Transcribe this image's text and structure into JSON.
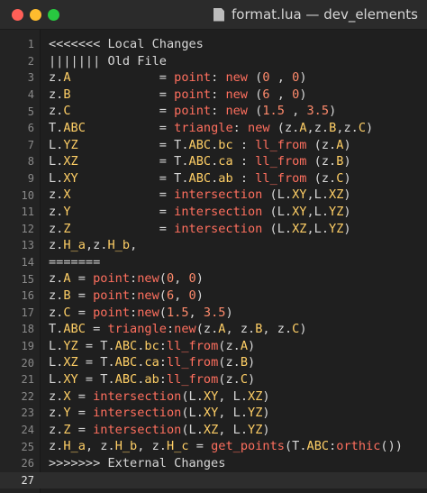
{
  "window": {
    "title": "format.lua — dev_elements",
    "icon": "lua-file-icon"
  },
  "editor": {
    "lines": [
      {
        "n": "1",
        "text": "<<<<<<< Local Changes"
      },
      {
        "n": "2",
        "text": "||||||| Old File"
      },
      {
        "n": "3",
        "text": "z.A            = point: new (0 , 0)"
      },
      {
        "n": "4",
        "text": "z.B            = point: new (6 , 0)"
      },
      {
        "n": "5",
        "text": "z.C            = point: new (1.5 , 3.5)"
      },
      {
        "n": "6",
        "text": "T.ABC          = triangle: new (z.A,z.B,z.C)"
      },
      {
        "n": "7",
        "text": "L.YZ           = T.ABC.bc : ll_from (z.A)"
      },
      {
        "n": "8",
        "text": "L.XZ           = T.ABC.ca : ll_from (z.B)"
      },
      {
        "n": "9",
        "text": "L.XY           = T.ABC.ab : ll_from (z.C)"
      },
      {
        "n": "10",
        "text": "z.X            = intersection (L.XY,L.XZ)"
      },
      {
        "n": "11",
        "text": "z.Y            = intersection (L.XY,L.YZ)"
      },
      {
        "n": "12",
        "text": "z.Z            = intersection (L.XZ,L.YZ)"
      },
      {
        "n": "13",
        "text": "z.H_a,z.H_b,"
      },
      {
        "n": "14",
        "text": "======="
      },
      {
        "n": "15",
        "text": "z.A = point:new(0, 0)"
      },
      {
        "n": "16",
        "text": "z.B = point:new(6, 0)"
      },
      {
        "n": "17",
        "text": "z.C = point:new(1.5, 3.5)"
      },
      {
        "n": "18",
        "text": "T.ABC = triangle:new(z.A, z.B, z.C)"
      },
      {
        "n": "19",
        "text": "L.YZ = T.ABC.bc:ll_from(z.A)"
      },
      {
        "n": "20",
        "text": "L.XZ = T.ABC.ca:ll_from(z.B)"
      },
      {
        "n": "21",
        "text": "L.XY = T.ABC.ab:ll_from(z.C)"
      },
      {
        "n": "22",
        "text": "z.X = intersection(L.XY, L.XZ)"
      },
      {
        "n": "23",
        "text": "z.Y = intersection(L.XY, L.YZ)"
      },
      {
        "n": "24",
        "text": "z.Z = intersection(L.XZ, L.YZ)"
      },
      {
        "n": "25",
        "text": "z.H_a, z.H_b, z.H_c = get_points(T.ABC:orthic())"
      },
      {
        "n": "26",
        "text": ">>>>>>> External Changes"
      },
      {
        "n": "27",
        "text": ""
      }
    ]
  },
  "colors": {
    "background": "#1f1f1f",
    "text": "#d7d7d7",
    "keyword": "#ff6f5e",
    "string": "#ffcf66"
  }
}
